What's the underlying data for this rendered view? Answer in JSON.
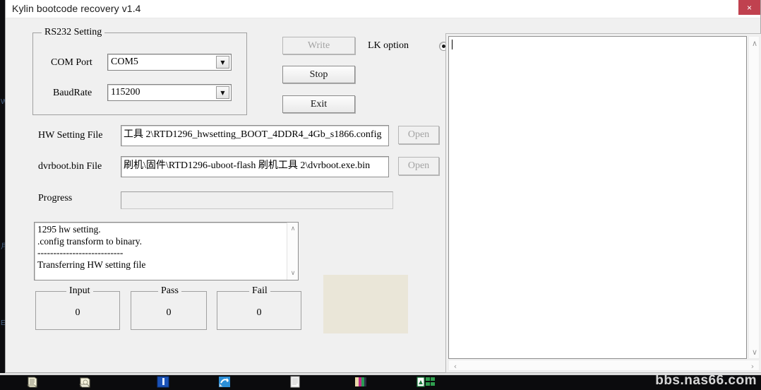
{
  "window": {
    "title": "Kylin bootcode recovery v1.4",
    "close_label": "×"
  },
  "rs232": {
    "group_title": "RS232 Setting",
    "com_port_label": "COM Port",
    "com_port_value": "COM5",
    "baud_rate_label": "BaudRate",
    "baud_rate_value": "115200",
    "arrow_glyph": "▼"
  },
  "actions": {
    "write_label": "Write",
    "write_enabled": false,
    "stop_label": "Stop",
    "exit_label": "Exit"
  },
  "lk_option": {
    "label": "LK option",
    "checked": true
  },
  "files": {
    "hw_setting_label": "HW Setting File",
    "hw_setting_value": "工具 2\\RTD1296_hwsetting_BOOT_4DDR4_4Gb_s1866.config",
    "hw_open_label": "Open",
    "dvrboot_label": "dvrboot.bin File",
    "dvrboot_value": "刷机\\固件\\RTD1296-uboot-flash 刷机工具 2\\dvrboot.exe.bin",
    "dvrboot_open_label": "Open",
    "open_enabled": false
  },
  "progress": {
    "label": "Progress",
    "percent": 0
  },
  "log": {
    "lines": [
      "1295 hw setting.",
      ".config transform to binary.",
      "---------------------------",
      "Transferring HW setting file"
    ],
    "scroll_up_glyph": "∧",
    "scroll_down_glyph": "∨"
  },
  "counters": [
    {
      "label": "Input",
      "value": "0"
    },
    {
      "label": "Pass",
      "value": "0"
    },
    {
      "label": "Fail",
      "value": "0"
    }
  ],
  "console": {
    "content": "",
    "scroll_up_glyph": "∧",
    "scroll_down_glyph": "∨",
    "scroll_left_glyph": "‹",
    "scroll_right_glyph": "›"
  },
  "taskbar": {
    "items": [
      {
        "name": "documents-folder-icon"
      },
      {
        "name": "folder-icon"
      },
      {
        "name": "blue-app-icon"
      },
      {
        "name": "browser-shortcut-icon"
      },
      {
        "name": "text-document-icon"
      },
      {
        "name": "media-player-icon"
      },
      {
        "name": "spreadsheet-icon"
      }
    ]
  },
  "watermark": {
    "text": "bbs.nas66.com"
  },
  "colors": {
    "accent_close": "#c0414f",
    "dialog_face": "#f0f0f0",
    "beige_panel": "#eae6d8",
    "field_white": "#ffffff"
  }
}
